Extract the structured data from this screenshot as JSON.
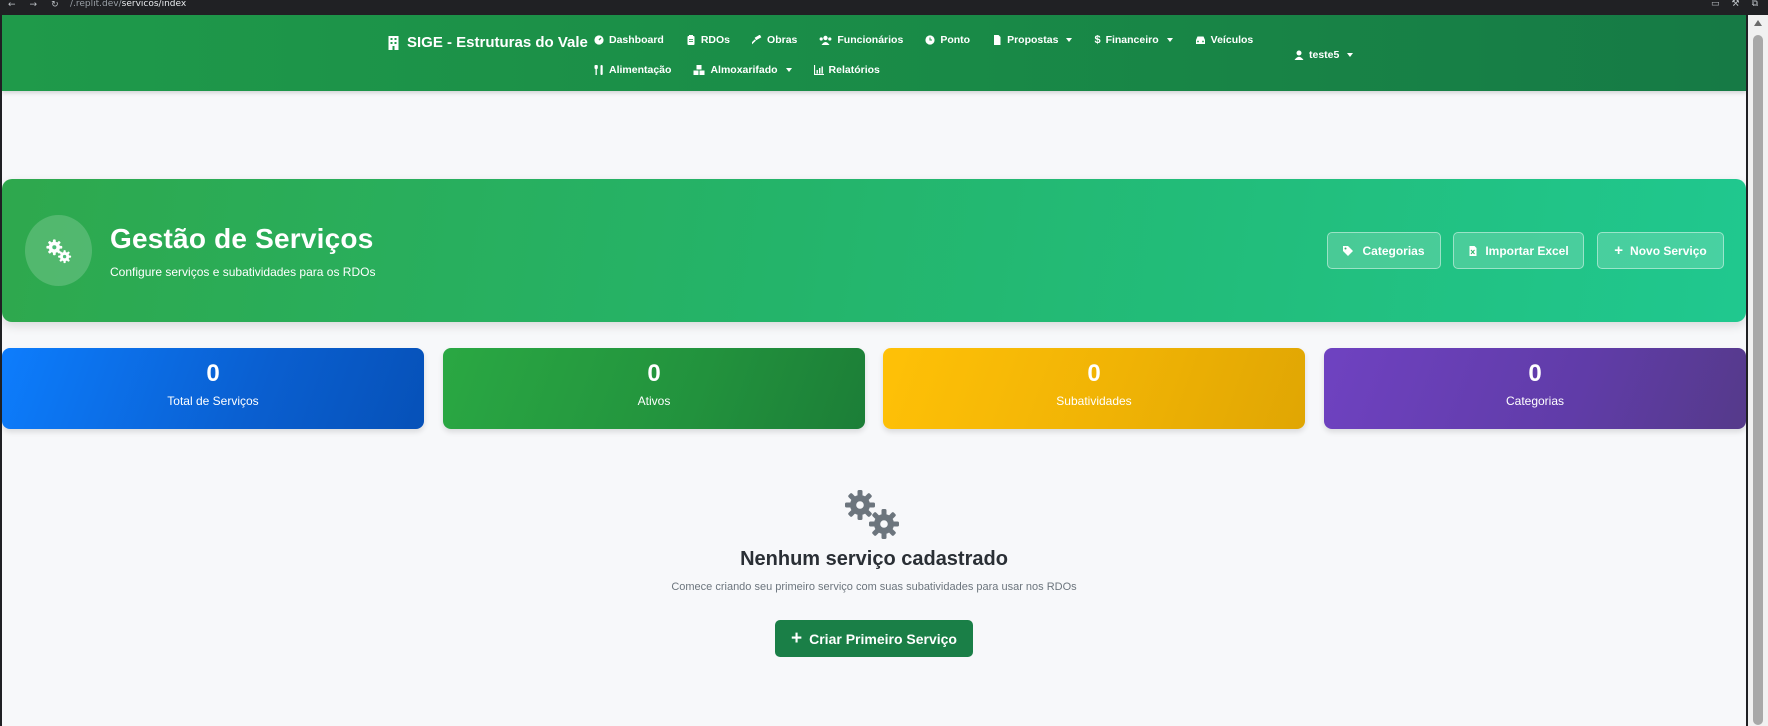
{
  "browser": {
    "url_prefix": "/.replit.dev/",
    "url_path": "servicos/index"
  },
  "navbar": {
    "brand": "SIGE - Estruturas do Vale",
    "row1": [
      {
        "label": "Dashboard",
        "icon": "dashboard-icon",
        "dropdown": false
      },
      {
        "label": "RDOs",
        "icon": "clipboard-icon",
        "dropdown": false
      },
      {
        "label": "Obras",
        "icon": "hammer-icon",
        "dropdown": false
      },
      {
        "label": "Funcionários",
        "icon": "users-icon",
        "dropdown": false
      },
      {
        "label": "Ponto",
        "icon": "clock-icon",
        "dropdown": false
      },
      {
        "label": "Propostas",
        "icon": "file-icon",
        "dropdown": true
      },
      {
        "label": "Financeiro",
        "icon": "dollar-icon",
        "dropdown": true
      },
      {
        "label": "Veículos",
        "icon": "car-icon",
        "dropdown": false
      }
    ],
    "row2": [
      {
        "label": "Alimentação",
        "icon": "utensils-icon",
        "dropdown": false
      },
      {
        "label": "Almoxarifado",
        "icon": "boxes-icon",
        "dropdown": true
      },
      {
        "label": "Relatórios",
        "icon": "chart-icon",
        "dropdown": false
      }
    ],
    "user": "teste5"
  },
  "hero": {
    "title": "Gestão de Serviços",
    "subtitle": "Configure serviços e subatividades para os RDOs",
    "buttons": {
      "categorias": "Categorias",
      "importar": "Importar Excel",
      "novo": "Novo Serviço"
    }
  },
  "stats": [
    {
      "value": "0",
      "label": "Total de Serviços",
      "color": "#0d6efd"
    },
    {
      "value": "0",
      "label": "Ativos",
      "color": "#28a745"
    },
    {
      "value": "0",
      "label": "Subatividades",
      "color": "#ffc107"
    },
    {
      "value": "0",
      "label": "Categorias",
      "color": "#6f42c1"
    }
  ],
  "empty": {
    "title": "Nenhum serviço cadastrado",
    "subtitle": "Comece criando seu primeiro serviço com suas subatividades para usar nos RDOs",
    "cta": "Criar Primeiro Serviço"
  },
  "colors": {
    "navbar": "#198a47",
    "hero_start": "#2ea84d",
    "hero_end": "#20c88f",
    "cta": "#1a7f47"
  }
}
